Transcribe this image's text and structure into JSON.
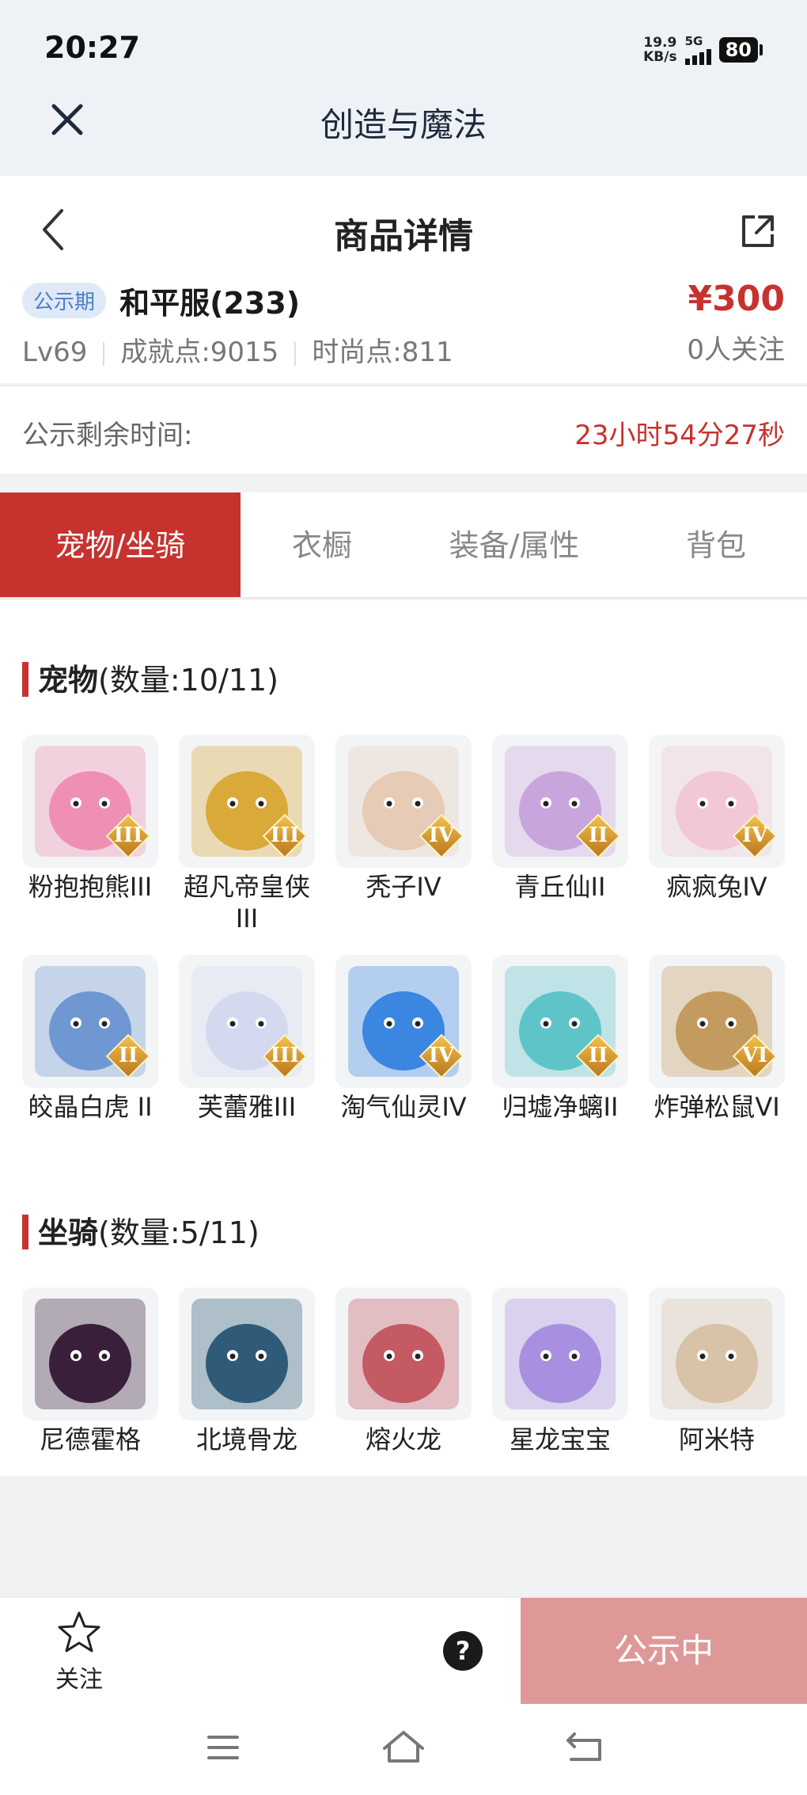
{
  "status_bar": {
    "time": "20:27",
    "net_speed_value": "19.9",
    "net_speed_unit": "KB/s",
    "network": "5G",
    "battery": "80"
  },
  "app": {
    "title": "创造与魔法",
    "close_icon": "close-icon"
  },
  "nav": {
    "title": "商品详情",
    "back_icon": "chevron-left-icon",
    "share_icon": "share-external-icon"
  },
  "listing": {
    "badge": "公示期",
    "server": "和平服(233)",
    "price": "¥300",
    "level": "Lv69",
    "achievement": "成就点:9015",
    "fashion": "时尚点:811",
    "followers": "0人关注"
  },
  "countdown": {
    "label": "公示剩余时间:",
    "value": "23小时54分27秒"
  },
  "tabs": [
    {
      "label": "宠物/坐骑",
      "active": true
    },
    {
      "label": "衣橱",
      "active": false
    },
    {
      "label": "装备/属性",
      "active": false
    },
    {
      "label": "背包",
      "active": false
    }
  ],
  "pets": {
    "title": "宠物",
    "count": "(数量:10/11)",
    "items": [
      {
        "name": "粉抱抱熊III",
        "level": "III",
        "color": "#f08fb5"
      },
      {
        "name": "超凡帝皇侠III",
        "level": "III",
        "color": "#d9a93a"
      },
      {
        "name": "秃子IV",
        "level": "IV",
        "color": "#e6cbb6"
      },
      {
        "name": "青丘仙II",
        "level": "II",
        "color": "#c9a5dd"
      },
      {
        "name": "疯疯兔IV",
        "level": "IV",
        "color": "#f2c7d8"
      },
      {
        "name": "皎晶白虎 II",
        "level": "II",
        "color": "#6f97d2"
      },
      {
        "name": "芙蕾雅III",
        "level": "III",
        "color": "#d4d9ef"
      },
      {
        "name": "淘气仙灵IV",
        "level": "IV",
        "color": "#3b86e0"
      },
      {
        "name": "归墟净螭II",
        "level": "II",
        "color": "#5ec4c8"
      },
      {
        "name": "炸弹松鼠VI",
        "level": "VI",
        "color": "#c49b5e"
      }
    ]
  },
  "mounts": {
    "title": "坐骑",
    "count": "(数量:5/11)",
    "items": [
      {
        "name": "尼德霍格",
        "color": "#3a1f3b"
      },
      {
        "name": "北境骨龙",
        "color": "#2f5b78"
      },
      {
        "name": "熔火龙",
        "color": "#c45a63"
      },
      {
        "name": "星龙宝宝",
        "color": "#a98fe0"
      },
      {
        "name": "阿米特",
        "color": "#d8c2a8"
      }
    ]
  },
  "footer": {
    "follow_label": "关注",
    "help": "?",
    "cta": "公示中"
  }
}
